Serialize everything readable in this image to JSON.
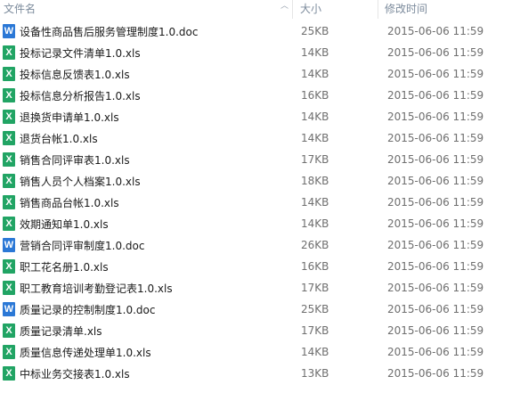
{
  "header": {
    "name_label": "文件名",
    "size_label": "大小",
    "date_label": "修改时间"
  },
  "files": [
    {
      "name": "设备性商品售后服务管理制度1.0.doc",
      "type": "doc",
      "icon_letter": "W",
      "size": "25KB",
      "modified": "2015-06-06 11:59"
    },
    {
      "name": "投标记录文件清单1.0.xls",
      "type": "xls",
      "icon_letter": "X",
      "size": "14KB",
      "modified": "2015-06-06 11:59"
    },
    {
      "name": "投标信息反馈表1.0.xls",
      "type": "xls",
      "icon_letter": "X",
      "size": "14KB",
      "modified": "2015-06-06 11:59"
    },
    {
      "name": "投标信息分析报告1.0.xls",
      "type": "xls",
      "icon_letter": "X",
      "size": "16KB",
      "modified": "2015-06-06 11:59"
    },
    {
      "name": "退换货申请单1.0.xls",
      "type": "xls",
      "icon_letter": "X",
      "size": "14KB",
      "modified": "2015-06-06 11:59"
    },
    {
      "name": "退货台帐1.0.xls",
      "type": "xls",
      "icon_letter": "X",
      "size": "14KB",
      "modified": "2015-06-06 11:59"
    },
    {
      "name": "销售合同评审表1.0.xls",
      "type": "xls",
      "icon_letter": "X",
      "size": "17KB",
      "modified": "2015-06-06 11:59"
    },
    {
      "name": "销售人员个人档案1.0.xls",
      "type": "xls",
      "icon_letter": "X",
      "size": "18KB",
      "modified": "2015-06-06 11:59"
    },
    {
      "name": "销售商品台帐1.0.xls",
      "type": "xls",
      "icon_letter": "X",
      "size": "14KB",
      "modified": "2015-06-06 11:59"
    },
    {
      "name": "效期通知单1.0.xls",
      "type": "xls",
      "icon_letter": "X",
      "size": "14KB",
      "modified": "2015-06-06 11:59"
    },
    {
      "name": "营销合同评审制度1.0.doc",
      "type": "doc",
      "icon_letter": "W",
      "size": "26KB",
      "modified": "2015-06-06 11:59"
    },
    {
      "name": "职工花名册1.0.xls",
      "type": "xls",
      "icon_letter": "X",
      "size": "16KB",
      "modified": "2015-06-06 11:59"
    },
    {
      "name": "职工教育培训考勤登记表1.0.xls",
      "type": "xls",
      "icon_letter": "X",
      "size": "17KB",
      "modified": "2015-06-06 11:59"
    },
    {
      "name": "质量记录的控制制度1.0.doc",
      "type": "doc",
      "icon_letter": "W",
      "size": "25KB",
      "modified": "2015-06-06 11:59"
    },
    {
      "name": "质量记录清单.xls",
      "type": "xls",
      "icon_letter": "X",
      "size": "17KB",
      "modified": "2015-06-06 11:59"
    },
    {
      "name": "质量信息传递处理单1.0.xls",
      "type": "xls",
      "icon_letter": "X",
      "size": "14KB",
      "modified": "2015-06-06 11:59"
    },
    {
      "name": "中标业务交接表1.0.xls",
      "type": "xls",
      "icon_letter": "X",
      "size": "13KB",
      "modified": "2015-06-06 11:59"
    }
  ],
  "colors": {
    "xls_icon": "#21a464",
    "doc_icon": "#2b78d6",
    "header_text": "#7c8b9c",
    "meta_text": "#6f6f6f"
  }
}
